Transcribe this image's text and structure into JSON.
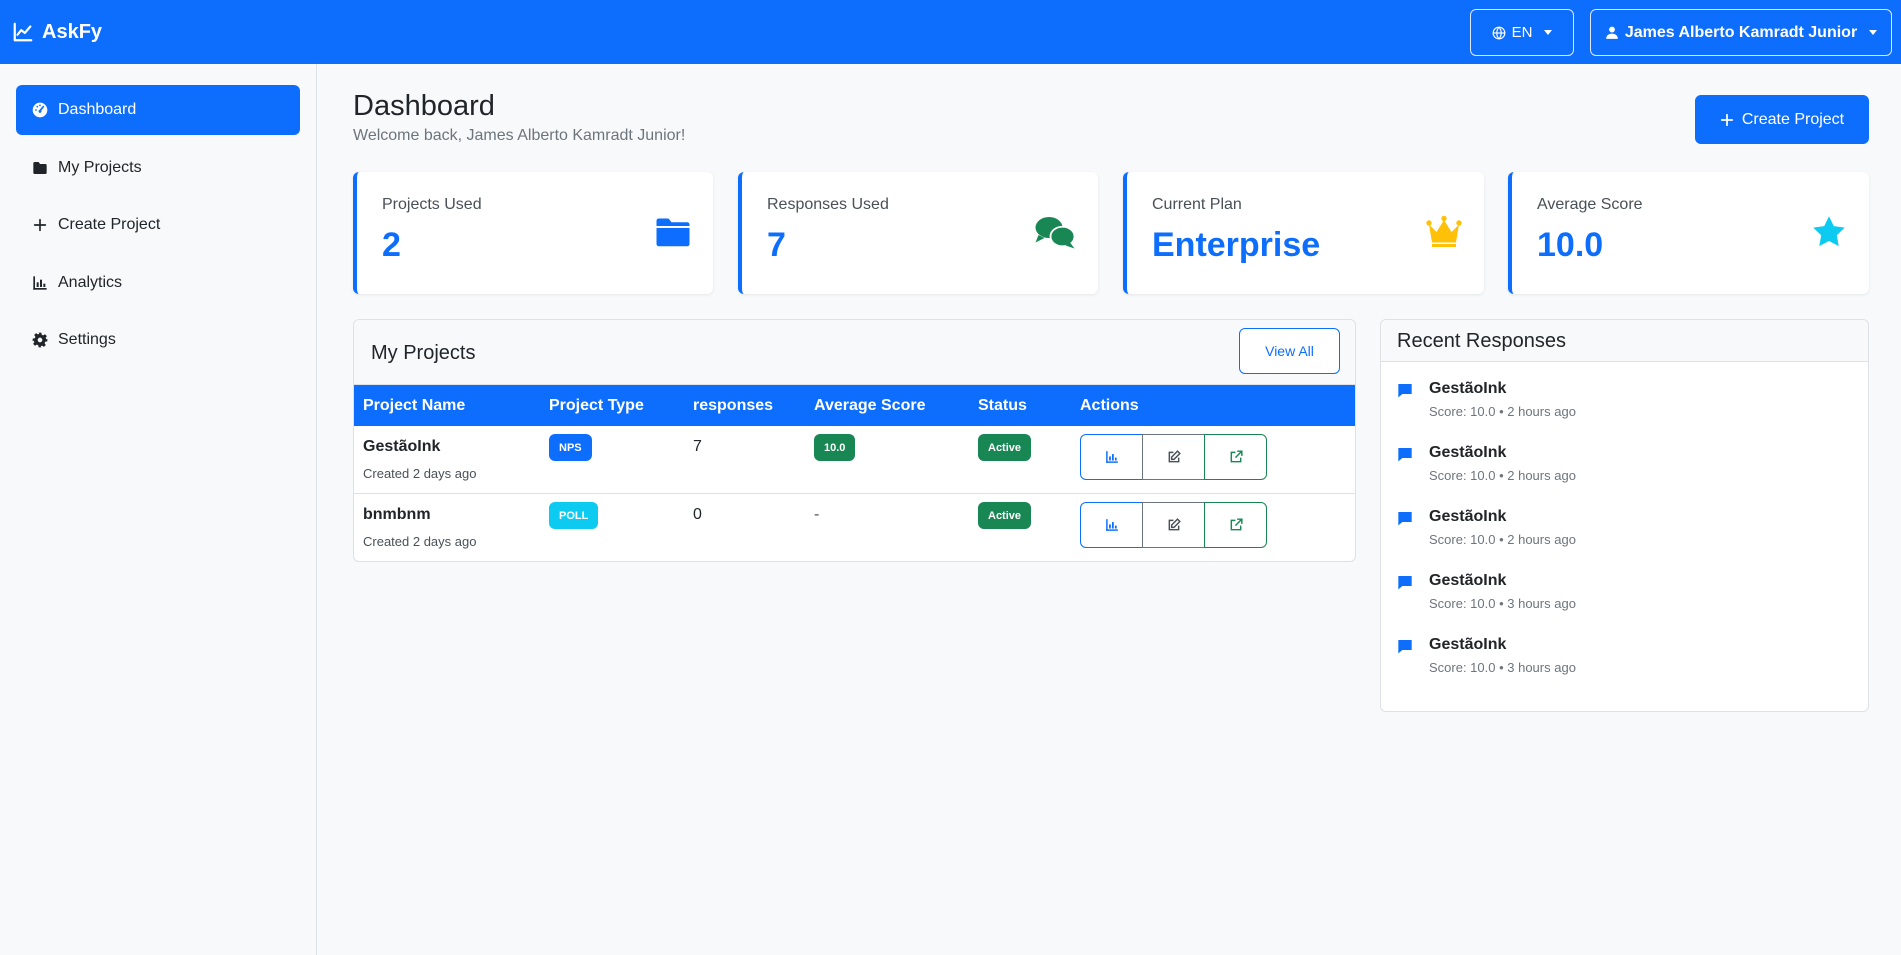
{
  "topbar": {
    "brand": "AskFy",
    "language": "EN",
    "user_name": "James Alberto Kamradt Junior"
  },
  "sidebar": {
    "items": [
      {
        "label": "Dashboard",
        "icon": "dashboard-icon",
        "active": true
      },
      {
        "label": "My Projects",
        "icon": "folder-icon"
      },
      {
        "label": "Create Project",
        "icon": "plus-icon"
      },
      {
        "label": "Analytics",
        "icon": "bar-chart-icon"
      },
      {
        "label": "Settings",
        "icon": "gear-icon"
      }
    ]
  },
  "header": {
    "title": "Dashboard",
    "welcome": "Welcome back, James Alberto Kamradt Junior!",
    "create_label": "Create Project"
  },
  "stats": [
    {
      "label": "Projects Used",
      "value": "2",
      "icon": "folder-icon",
      "color": "#0d6efd"
    },
    {
      "label": "Responses Used",
      "value": "7",
      "icon": "comments-icon",
      "color": "#198754"
    },
    {
      "label": "Current Plan",
      "value": "Enterprise",
      "icon": "crown-icon",
      "color": "#ffc107"
    },
    {
      "label": "Average Score",
      "value": "10.0",
      "icon": "star-icon",
      "color": "#0dcaf0"
    }
  ],
  "projects": {
    "title": "My Projects",
    "view_all": "View All",
    "columns": [
      "Project Name",
      "Project Type",
      "responses",
      "Average Score",
      "Status",
      "Actions"
    ],
    "rows": [
      {
        "name": "GestãoInk",
        "created": "Created 2 days ago",
        "type": "NPS",
        "type_color": "#0d6efd",
        "responses": "7",
        "score": "10.0",
        "status": "Active"
      },
      {
        "name": "bnmbnm",
        "created": "Created 2 days ago",
        "type": "POLL",
        "type_color": "#0dcaf0",
        "responses": "0",
        "score": "-",
        "status": "Active"
      }
    ]
  },
  "recent": {
    "title": "Recent Responses",
    "items": [
      {
        "name": "GestãoInk",
        "meta": "Score: 10.0 • 2 hours ago"
      },
      {
        "name": "GestãoInk",
        "meta": "Score: 10.0 • 2 hours ago"
      },
      {
        "name": "GestãoInk",
        "meta": "Score: 10.0 • 2 hours ago"
      },
      {
        "name": "GestãoInk",
        "meta": "Score: 10.0 • 3 hours ago"
      },
      {
        "name": "GestãoInk",
        "meta": "Score: 10.0 • 3 hours ago"
      }
    ]
  },
  "colors": {
    "primary": "#0d6efd",
    "success": "#198754",
    "info": "#0dcaf0",
    "warning": "#ffc107"
  }
}
